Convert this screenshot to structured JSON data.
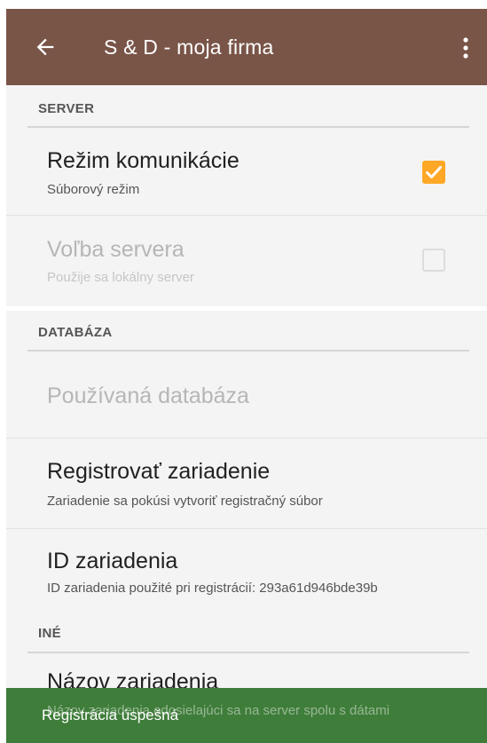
{
  "toolbar": {
    "title": "S & D - moja firma",
    "back_icon": "arrow-left-icon",
    "more_icon": "more-vert-icon",
    "color": "#795548"
  },
  "sections": {
    "server": {
      "header": "SERVER",
      "items": [
        {
          "title": "Režim komunikácie",
          "summary": "Súborový režim",
          "checked": true,
          "enabled": true
        },
        {
          "title": "Voľba servera",
          "summary": "Použije sa lokálny server",
          "checked": false,
          "enabled": false
        }
      ]
    },
    "database": {
      "header": "DATABÁZA",
      "items": [
        {
          "title": "Používaná databáza",
          "enabled": false
        },
        {
          "title": "Registrovať zariadenie",
          "summary": "Zariadenie sa pokúsi vytvoriť registračný súbor",
          "enabled": true
        },
        {
          "title": "ID zariadenia",
          "summary": "ID zariadenia použité pri registrácií: 293a61d946bde39b",
          "enabled": true
        }
      ]
    },
    "other": {
      "header": "INÉ",
      "items": [
        {
          "title": "Názov zariadenia",
          "summary": "Názov zariadenia odosielajúci sa na server spolu s dátami",
          "enabled": true
        }
      ]
    }
  },
  "snackbar": {
    "message": "Registrácia úspešná",
    "color": "#3f7d3a"
  },
  "accent_color": "#ffa726"
}
